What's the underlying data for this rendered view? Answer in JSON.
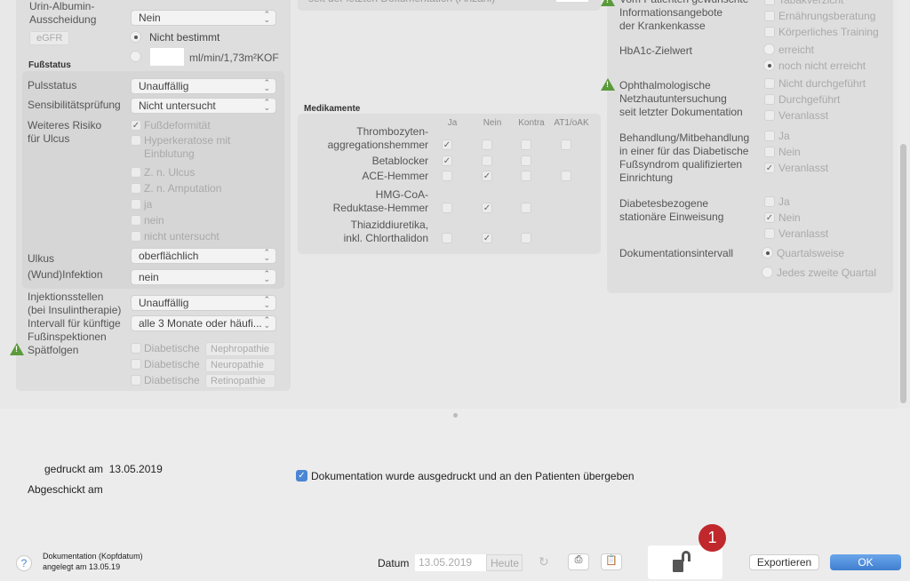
{
  "left": {
    "urin_label": "Urin-Albumin-\nAusscheidung",
    "urin_value": "Nein",
    "egfr_label": "eGFR",
    "egfr_opt1": "Nicht bestimmt",
    "egfr_unit": "ml/min/1,73m²KOF",
    "egfr_value": "",
    "fuss_title": "Fußstatus",
    "puls_label": "Pulsstatus",
    "puls_value": "Unauffällig",
    "sens_label": "Sensibilitätsprüfung",
    "sens_value": "Nicht untersucht",
    "risiko_label": "Weiteres Risiko\nfür Ulcus",
    "risiko_opts": [
      {
        "label": "Fußdeformität",
        "checked": true
      },
      {
        "label": "Hyperkeratose mit\nEinblutung",
        "checked": false
      },
      {
        "label": "Z. n. Ulcus",
        "checked": false
      },
      {
        "label": "Z. n. Amputation",
        "checked": false
      },
      {
        "label": "ja",
        "checked": false
      },
      {
        "label": "nein",
        "checked": false
      },
      {
        "label": "nicht untersucht",
        "checked": false
      }
    ],
    "ulkus_label": "Ulkus",
    "ulkus_value": "oberflächlich",
    "infekt_label": "(Wund)Infektion",
    "infekt_value": "nein",
    "inj_label": "Injektionsstellen\n(bei Insulintherapie)",
    "inj_value": "Unauffällig",
    "intervall_label": "Intervall für künftige\nFußinspektionen",
    "intervall_value": "alle 3 Monate oder häufi...",
    "spaet_label": "Spätfolgen",
    "spaet_prefix": "Diabetische",
    "spaet_opts": [
      "Nephropathie",
      "Neuropathie",
      "Retinopathie"
    ]
  },
  "middle": {
    "top_cut": "seit der letzten Dokumentation (Anzahl)",
    "med_title": "Medikamente",
    "cols": [
      "Ja",
      "Nein",
      "Kontra",
      "AT1/oAK"
    ],
    "rows": [
      {
        "label": "Thrombozyten-\naggregationshemmer",
        "checks": [
          true,
          false,
          false,
          false
        ]
      },
      {
        "label": "Betablocker",
        "checks": [
          true,
          false,
          false,
          null
        ]
      },
      {
        "label": "ACE-Hemmer",
        "checks": [
          false,
          true,
          false,
          false
        ]
      },
      {
        "label": "HMG-CoA-\nReduktase-Hemmer",
        "checks": [
          false,
          true,
          false,
          null
        ]
      },
      {
        "label": "Thiaziddiuretika,\ninkl. Chlorthalidon",
        "checks": [
          false,
          true,
          false,
          null
        ]
      }
    ]
  },
  "right": {
    "info_label": "Vom Patienten gewünschte\nInformationsangebote\nder Krankenkasse",
    "info_opts": [
      "Tabakverzicht",
      "Ernährungsberatung",
      "Körperliches Training"
    ],
    "hba_label": "HbA1c-Zielwert",
    "hba_opts": [
      "erreicht",
      "noch nicht erreicht"
    ],
    "hba_selected": 1,
    "oph_label": "Ophthalmologische\nNetzhautuntersuchung\nseit letzter Dokumentation",
    "oph_opts": [
      "Nicht durchgeführt",
      "Durchgeführt",
      "Veranlasst"
    ],
    "beh_label": "Behandlung/Mitbehandlung\nin einer für das Diabetische\nFußsyndrom qualifizierten\nEinrichtung",
    "beh_opts": [
      {
        "label": "Ja",
        "checked": false
      },
      {
        "label": "Nein",
        "checked": false
      },
      {
        "label": "Veranlasst",
        "checked": true
      }
    ],
    "stat_label": "Diabetesbezogene\nstationäre Einweisung",
    "stat_opts": [
      {
        "label": "Ja",
        "checked": false
      },
      {
        "label": "Nein",
        "checked": true
      },
      {
        "label": "Veranlasst",
        "checked": false
      }
    ],
    "doku_label": "Dokumentationsintervall",
    "doku_opts": [
      "Quartalsweise",
      "Jedes zweite Quartal"
    ],
    "doku_selected": 0
  },
  "bottom": {
    "gedruckt": "gedruckt am  13.05.2019",
    "abgeschickt": "Abgeschickt am",
    "printed_check": "Dokumentation wurde ausgedruckt und an den Patienten übergeben",
    "help": "?",
    "doc_info1": "Dokumentation (Kopfdatum)",
    "doc_info2": "angelegt am 13.05.19",
    "datum_label": "Datum",
    "datum_value": "13.05.2019",
    "heute": "Heute",
    "badge": "1",
    "export": "Exportieren",
    "ok": "OK"
  },
  "colors": {
    "accent": "#4a86d4",
    "badge": "#c0282d",
    "warn": "#5a9a3a"
  }
}
